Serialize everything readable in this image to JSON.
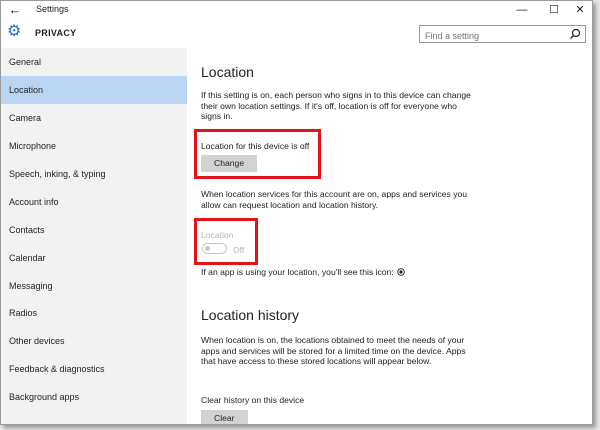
{
  "window": {
    "title": "Settings",
    "back_glyph": "←",
    "minimize_glyph": "—",
    "maximize_glyph": "☐",
    "close_glyph": "✕"
  },
  "header": {
    "app_title": "PRIVACY",
    "gear_glyph": "⚙"
  },
  "search": {
    "placeholder": "Find a setting"
  },
  "sidebar": {
    "items": [
      {
        "label": "General"
      },
      {
        "label": "Location"
      },
      {
        "label": "Camera"
      },
      {
        "label": "Microphone"
      },
      {
        "label": "Speech, inking, & typing"
      },
      {
        "label": "Account info"
      },
      {
        "label": "Contacts"
      },
      {
        "label": "Calendar"
      },
      {
        "label": "Messaging"
      },
      {
        "label": "Radios"
      },
      {
        "label": "Other devices"
      },
      {
        "label": "Feedback & diagnostics"
      },
      {
        "label": "Background apps"
      }
    ],
    "active_index": 1
  },
  "main": {
    "heading": "Location",
    "intro": "If this setting is on, each person who signs in to this device can change their own location settings. If it's off, location is off for everyone who signs in.",
    "device_status": "Location for this device is off",
    "change_button": "Change",
    "account_text": "When location services for this account are on, apps and services you allow can request location and location history.",
    "toggle_label": "Location",
    "toggle_state": "Off",
    "icon_note": "If an app is using your location, you'll see this icon:",
    "history_heading": "Location history",
    "history_text": "When location is on, the locations obtained to meet the needs of your apps and services will be stored for a limited time on the device. Apps that have access to these stored locations will appear below.",
    "clear_label": "Clear history on this device",
    "clear_button": "Clear"
  },
  "colors": {
    "highlight": "#e3121b",
    "active_nav": "#b9d5f1",
    "accent": "#1f6fc5"
  }
}
